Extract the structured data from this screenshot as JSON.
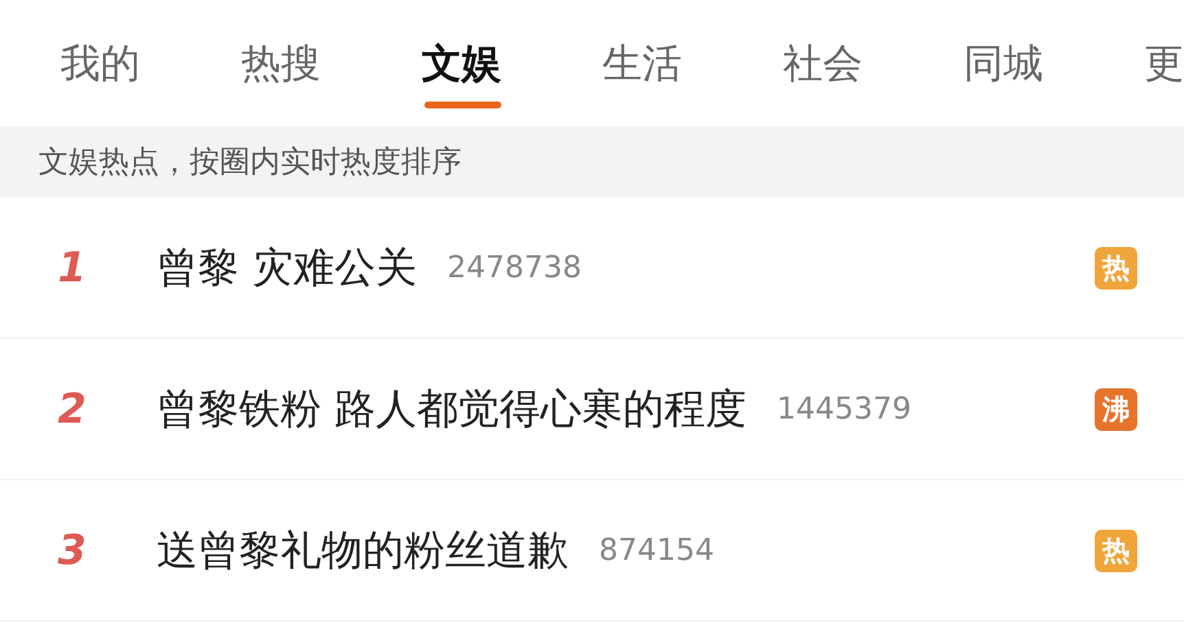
{
  "tabs": [
    {
      "label": "我的",
      "selected": false
    },
    {
      "label": "热搜",
      "selected": false
    },
    {
      "label": "文娱",
      "selected": true
    },
    {
      "label": "生活",
      "selected": false
    },
    {
      "label": "社会",
      "selected": false
    },
    {
      "label": "同城",
      "selected": false
    },
    {
      "label": "更",
      "selected": false
    }
  ],
  "notice": "文娱热点，按圈内实时热度排序",
  "items": [
    {
      "rank": "1",
      "title": "曾黎 灾难公关",
      "count": "2478738",
      "badge": "热",
      "color": "#f0a53a"
    },
    {
      "rank": "2",
      "title": "曾黎铁粉 路人都觉得心寒的程度",
      "count": "1445379",
      "badge": "沸",
      "color": "#e8732c"
    },
    {
      "rank": "3",
      "title": "送曾黎礼物的粉丝道歉",
      "count": "874154",
      "badge": "热",
      "color": "#f0a53a"
    }
  ]
}
